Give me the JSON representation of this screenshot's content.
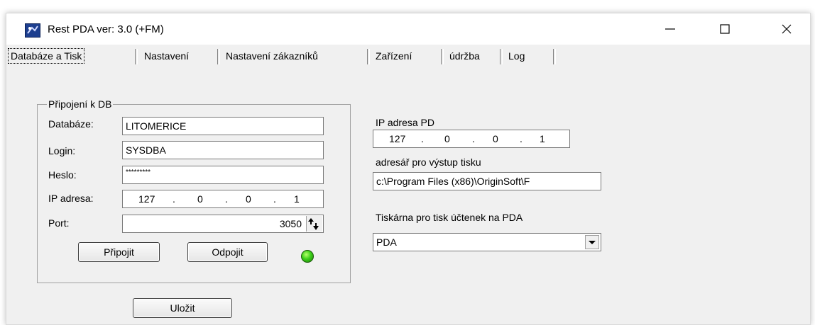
{
  "window": {
    "title": "Rest PDA ver: 3.0 (+FM)"
  },
  "tabs": [
    {
      "label": "Databáze a Tisk"
    },
    {
      "label": "Nastavení"
    },
    {
      "label": "Nastavení zákazníků"
    },
    {
      "label": "Zařízení"
    },
    {
      "label": "údržba"
    },
    {
      "label": "Log"
    }
  ],
  "db_group": {
    "title": "Připojení k DB",
    "database_label": "Databáze:",
    "database_value": "LITOMERICE",
    "login_label": "Login:",
    "login_value": "SYSDBA",
    "password_label": "Heslo:",
    "password_value": "*********",
    "ip_label": "IP adresa:",
    "ip": [
      "127",
      "0",
      "0",
      "1"
    ],
    "port_label": "Port:",
    "port_value": "3050",
    "connect_button": "Připojit",
    "disconnect_button": "Odpojit",
    "status_color": "#3ccf1a"
  },
  "save_button": "Uložit",
  "right_panel": {
    "ip_pd_label": "IP adresa PD",
    "ip_pd": [
      "127",
      "0",
      "0",
      "1"
    ],
    "print_dir_label": "adresář pro výstup tisku",
    "print_dir_value": "c:\\Program Files (x86)\\OriginSoft\\F",
    "printer_label": "Tiskárna pro tisk účtenek na PDA",
    "printer_value": "PDA"
  }
}
